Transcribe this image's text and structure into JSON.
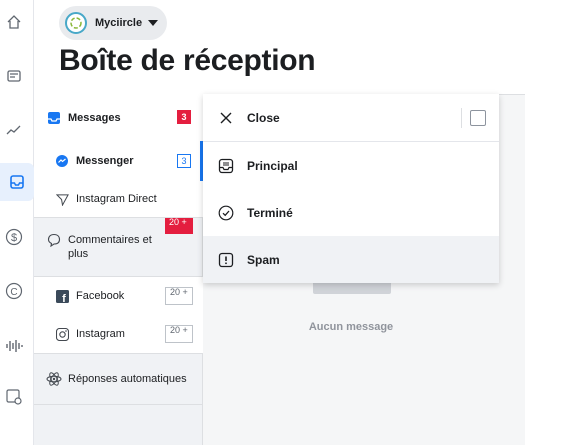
{
  "account": {
    "name": "Myciircle"
  },
  "page": {
    "title": "Boîte de réception"
  },
  "rail": {
    "icons": [
      "home-icon",
      "pages-icon",
      "insights-icon",
      "inbox-icon",
      "monetization-icon",
      "copyright-icon",
      "audio-icon",
      "settings-icon"
    ]
  },
  "sidebar": {
    "messages": {
      "label": "Messages",
      "badge": "3"
    },
    "messenger": {
      "label": "Messenger",
      "badge": "3"
    },
    "instagram_direct": {
      "label": "Instagram Direct"
    },
    "comments": {
      "label": "Commentaires et plus",
      "badge": "20 +"
    },
    "facebook": {
      "label": "Facebook",
      "badge": "20 +"
    },
    "instagram": {
      "label": "Instagram",
      "badge": "20 +"
    },
    "auto_replies": {
      "label": "Réponses automatiques"
    }
  },
  "dropdown": {
    "close_label": "Close",
    "items": [
      {
        "label": "Principal",
        "icon": "inbox-tray-icon"
      },
      {
        "label": "Terminé",
        "icon": "check-circle-icon"
      },
      {
        "label": "Spam",
        "icon": "exclamation-icon"
      }
    ]
  },
  "main": {
    "empty_text": "Aucun message"
  },
  "colors": {
    "accent": "#1877f2",
    "badge_red": "#e41e3f"
  }
}
